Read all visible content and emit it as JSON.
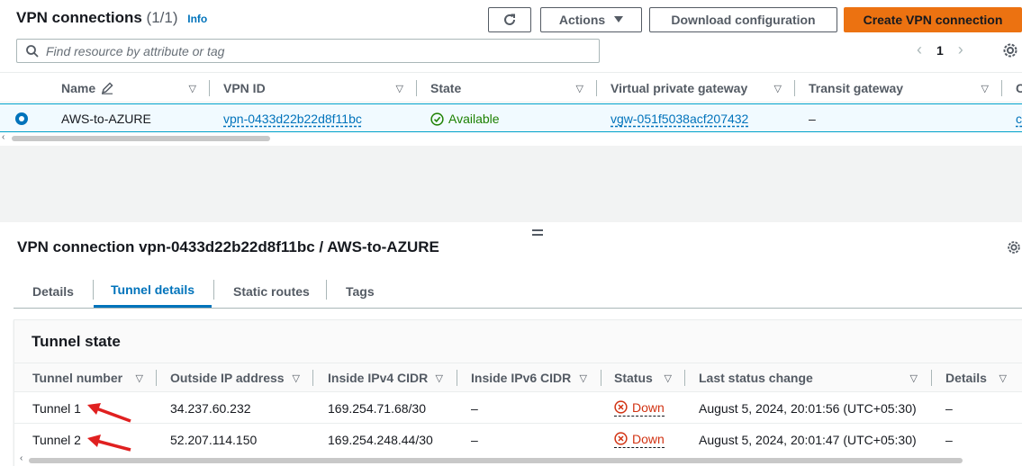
{
  "header": {
    "title": "VPN connections",
    "count": "(1/1)",
    "info": "Info",
    "actions_label": "Actions",
    "download_label": "Download configuration",
    "create_label": "Create VPN connection",
    "search_placeholder": "Find resource by attribute or tag",
    "page_number": "1"
  },
  "vpn_table": {
    "columns": [
      "Name",
      "VPN ID",
      "State",
      "Virtual private gateway",
      "Transit gateway"
    ],
    "truncated_column_letter": "C",
    "rows": [
      {
        "name": "AWS-to-AZURE",
        "vpn_id": "vpn-0433d22b22d8f11bc",
        "state": "Available",
        "vgw": "vgw-051f5038acf207432",
        "transit_gateway": "–",
        "truncated_cell": "c"
      }
    ]
  },
  "detail": {
    "title": "VPN connection vpn-0433d22b22d8f11bc / AWS-to-AZURE",
    "tabs": [
      "Details",
      "Tunnel details",
      "Static routes",
      "Tags"
    ],
    "active_tab": "Tunnel details"
  },
  "tunnel_state": {
    "title": "Tunnel state",
    "columns": [
      "Tunnel number",
      "Outside IP address",
      "Inside IPv4 CIDR",
      "Inside IPv6 CIDR",
      "Status",
      "Last status change",
      "Details"
    ],
    "rows": [
      {
        "tunnel": "Tunnel 1",
        "outside_ip": "34.237.60.232",
        "inside_ipv4": "169.254.71.68/30",
        "inside_ipv6": "–",
        "status": "Down",
        "last_change": "August 5, 2024, 20:01:56 (UTC+05:30)",
        "details": "–"
      },
      {
        "tunnel": "Tunnel 2",
        "outside_ip": "52.207.114.150",
        "inside_ipv4": "169.254.248.44/30",
        "inside_ipv6": "–",
        "status": "Down",
        "last_change": "August 5, 2024, 20:01:47 (UTC+05:30)",
        "details": "–"
      }
    ]
  },
  "colors": {
    "primary_button": "#ec7211",
    "link": "#0073bb",
    "success": "#1d8102",
    "error": "#d13212",
    "annotation_arrow": "#e02020"
  }
}
